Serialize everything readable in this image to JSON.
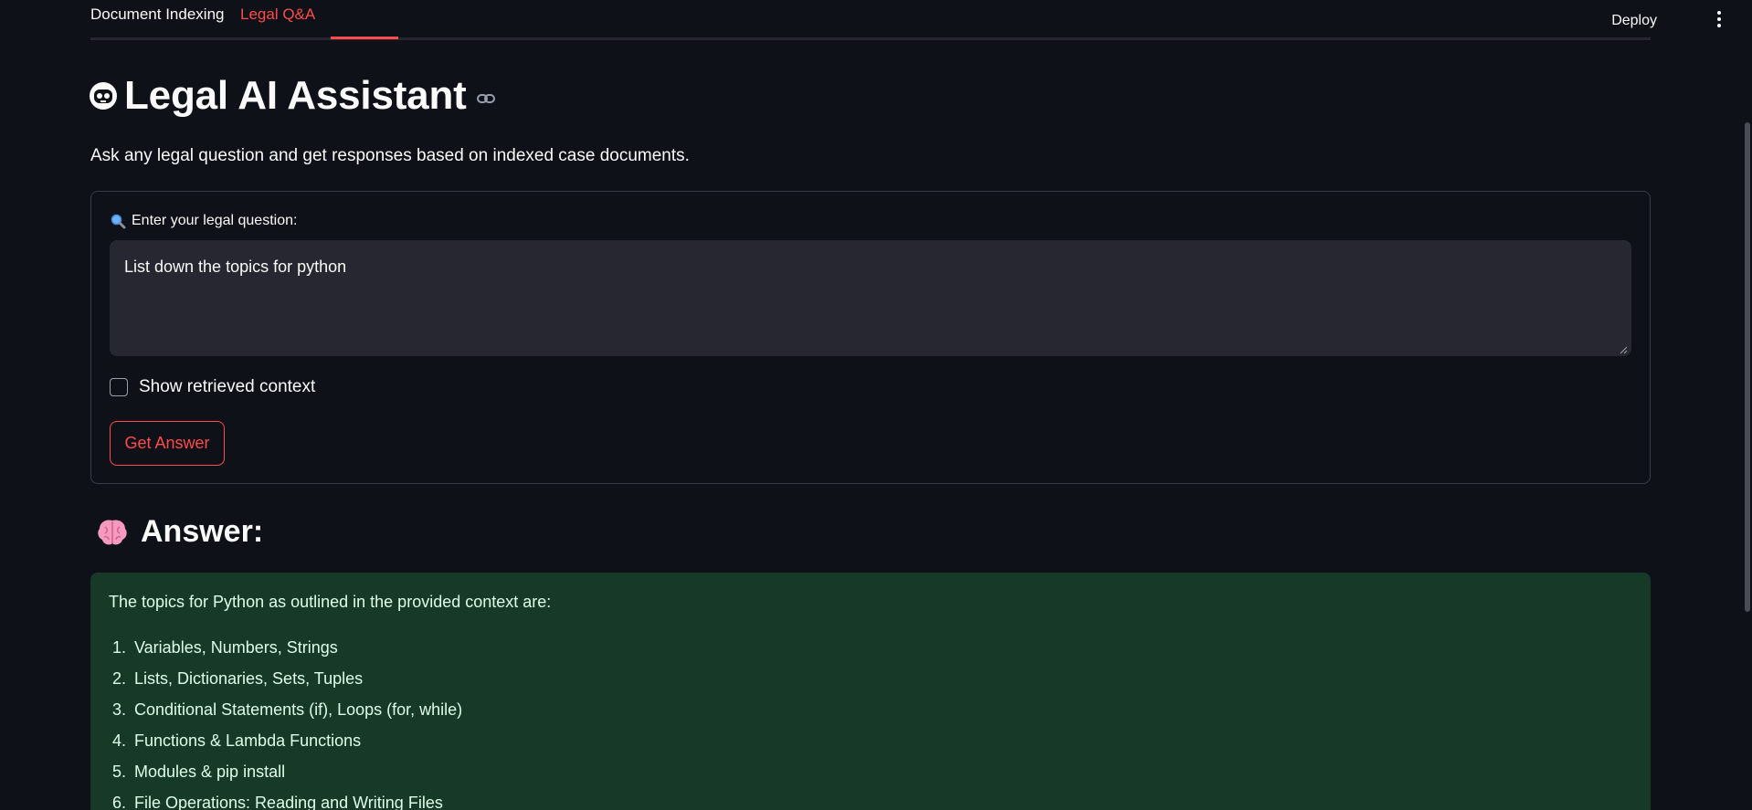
{
  "tabs": [
    {
      "label": "Document Indexing",
      "active": false
    },
    {
      "label": "Legal Q&A",
      "active": true
    }
  ],
  "header": {
    "deploy_label": "Deploy",
    "menu_icon": "more-vertical-icon"
  },
  "title": {
    "icon": "robot-icon",
    "text": "Legal AI Assistant",
    "link_icon": "link-icon"
  },
  "subtitle": "Ask any legal question and get responses based on indexed case documents.",
  "form": {
    "label_icon": "magnifier-icon",
    "label": "Enter your legal question:",
    "question_value": "List down the topics for python",
    "checkbox_label": "Show retrieved context",
    "checkbox_checked": false,
    "submit_label": "Get Answer"
  },
  "answer": {
    "icon": "brain-icon",
    "heading": "Answer:",
    "intro": "The topics for Python as outlined in the provided context are:",
    "items": [
      {
        "num": "1.",
        "text": "Variables, Numbers, Strings"
      },
      {
        "num": "2.",
        "text": "Lists, Dictionaries, Sets, Tuples"
      },
      {
        "num": "3.",
        "text": "Conditional Statements (if), Loops (for, while)"
      },
      {
        "num": "4.",
        "text": "Functions & Lambda Functions"
      },
      {
        "num": "5.",
        "text": "Modules & pip install"
      },
      {
        "num": "6.",
        "text": "File Operations: Reading and Writing Files"
      }
    ]
  },
  "colors": {
    "background": "#0e1117",
    "accent": "#ff4b4b",
    "answer_bg": "#173928",
    "input_bg": "#262730"
  }
}
